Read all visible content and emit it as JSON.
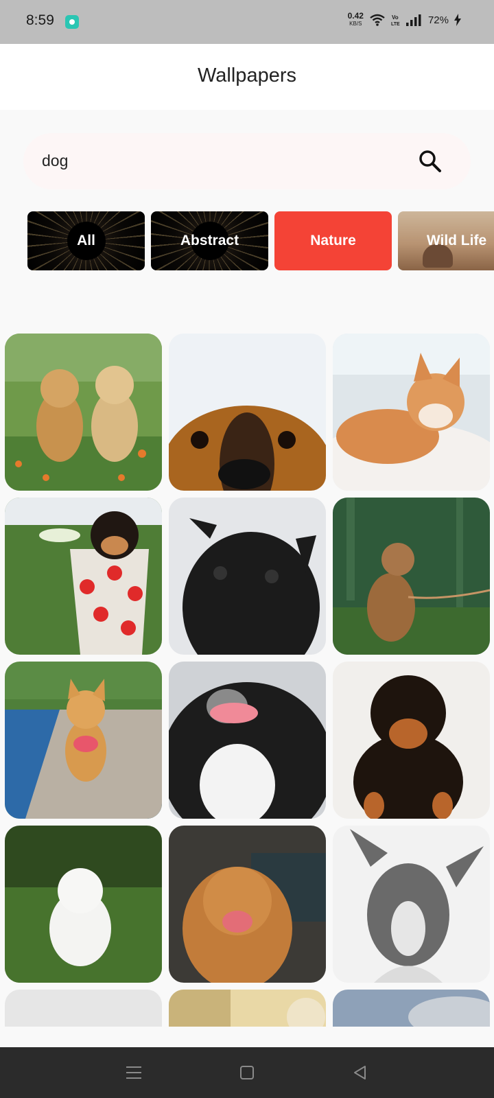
{
  "status_bar": {
    "time": "8:59",
    "net_speed": "0.42",
    "net_unit": "KB/S",
    "volte": "Vo LTE",
    "battery": "72%"
  },
  "app_bar": {
    "title": "Wallpapers"
  },
  "search": {
    "value": "dog",
    "icon": "search-icon"
  },
  "categories": [
    {
      "label": "All",
      "selected": false
    },
    {
      "label": "Abstract",
      "selected": false
    },
    {
      "label": "Nature",
      "selected": true
    },
    {
      "label": "Wild Life",
      "selected": false
    }
  ],
  "wallpapers": [
    {
      "subject": "two golden retriever puppies on grass with flowers",
      "colors": [
        "#6f9a4a",
        "#c8924e"
      ]
    },
    {
      "subject": "close-up of brown dog face peeking from bottom",
      "colors": [
        "#eef2f6",
        "#a9651f"
      ]
    },
    {
      "subject": "shiba inu lying on white blanket by window",
      "colors": [
        "#dfe6ea",
        "#d98b4d"
      ]
    },
    {
      "subject": "chihuahua puppy in red polka dot cup",
      "colors": [
        "#4f7d36",
        "#e9e4dc"
      ]
    },
    {
      "subject": "black pug looking up",
      "colors": [
        "#e4e6e9",
        "#1b1b1b"
      ]
    },
    {
      "subject": "spaniel puppy on leash in forest",
      "colors": [
        "#2f5a3a",
        "#9c6a3c"
      ]
    },
    {
      "subject": "corgi walking on pier by water",
      "colors": [
        "#2d6aa8",
        "#d89a4e"
      ]
    },
    {
      "subject": "black and white dog smiling",
      "colors": [
        "#cfd2d6",
        "#1c1c1c"
      ]
    },
    {
      "subject": "rottweiler puppy sitting",
      "colors": [
        "#f1efec",
        "#1e140d"
      ]
    },
    {
      "subject": "white fluffy puppy on grass",
      "colors": [
        "#47732d",
        "#f4f4f2"
      ]
    },
    {
      "subject": "golden retriever smiling in cafe",
      "colors": [
        "#3c3a36",
        "#c27c3a"
      ]
    },
    {
      "subject": "black and white portrait of pit bull",
      "colors": [
        "#f2f2f2",
        "#6a6a6a"
      ]
    },
    {
      "subject": "partially visible wallpaper",
      "colors": [
        "#e6e6e6",
        "#b8b8b8"
      ]
    },
    {
      "subject": "partially visible wallpaper",
      "colors": [
        "#e9d8a6",
        "#a68d52"
      ]
    },
    {
      "subject": "partially visible wallpaper",
      "colors": [
        "#8ea1b8",
        "#c9cfd6"
      ]
    }
  ],
  "nav_bar": {
    "buttons": [
      "menu-icon",
      "home-icon",
      "back-icon"
    ]
  }
}
